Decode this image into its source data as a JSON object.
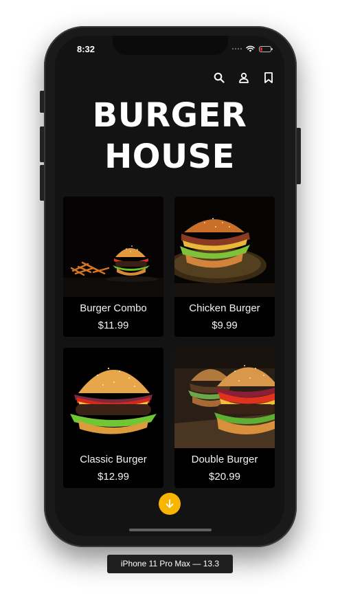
{
  "status_bar": {
    "time": "8:32",
    "battery_level": 0.2,
    "battery_color": "#e02a2a"
  },
  "header": {
    "icons": [
      "search-icon",
      "profile-icon",
      "bookmark-icon"
    ]
  },
  "title": {
    "line1": "BURGER",
    "line2": "HOUSE"
  },
  "menu": {
    "items": [
      {
        "name": "Burger Combo",
        "price": "$11.99"
      },
      {
        "name": "Chicken Burger",
        "price": "$9.99"
      },
      {
        "name": "Classic Burger",
        "price": "$12.99"
      },
      {
        "name": "Double Burger",
        "price": "$20.99"
      }
    ]
  },
  "fab": {
    "icon": "arrow-down-icon",
    "color": "#f7b500"
  },
  "device_label": "iPhone 11 Pro Max — 13.3",
  "colors": {
    "screen_bg": "#131313",
    "card_bg": "#000000",
    "accent": "#f7b500",
    "text": "#ffffff"
  }
}
